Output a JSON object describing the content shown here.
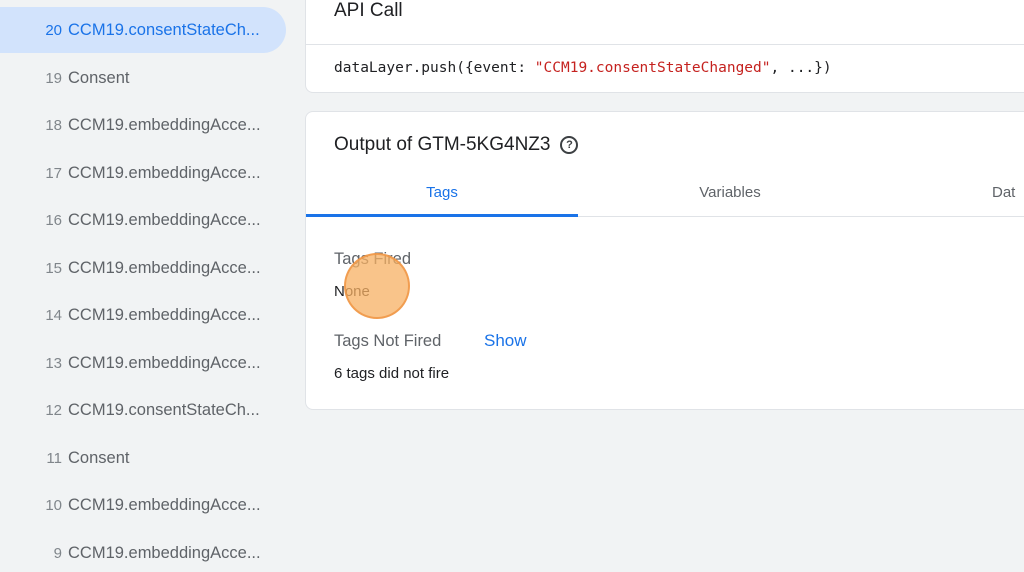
{
  "sidebar": {
    "items": [
      {
        "num": "20",
        "label": "CCM19.consentStateCh...",
        "active": true
      },
      {
        "num": "19",
        "label": "Consent"
      },
      {
        "num": "18",
        "label": "CCM19.embeddingAcce..."
      },
      {
        "num": "17",
        "label": "CCM19.embeddingAcce..."
      },
      {
        "num": "16",
        "label": "CCM19.embeddingAcce..."
      },
      {
        "num": "15",
        "label": "CCM19.embeddingAcce..."
      },
      {
        "num": "14",
        "label": "CCM19.embeddingAcce..."
      },
      {
        "num": "13",
        "label": "CCM19.embeddingAcce..."
      },
      {
        "num": "12",
        "label": "CCM19.consentStateCh..."
      },
      {
        "num": "11",
        "label": "Consent"
      },
      {
        "num": "10",
        "label": "CCM19.embeddingAcce..."
      },
      {
        "num": "9",
        "label": "CCM19.embeddingAcce..."
      }
    ]
  },
  "api_call": {
    "title": "API Call",
    "code_prefix": "dataLayer.push({event: ",
    "code_string": "\"CCM19.consentStateChanged\"",
    "code_suffix": ", ...})"
  },
  "output": {
    "title": "Output of GTM-5KG4NZ3",
    "help_icon": "help-circle-icon",
    "tabs": [
      {
        "label": "Tags",
        "active": true
      },
      {
        "label": "Variables"
      },
      {
        "label": "Dat"
      }
    ],
    "tags_fired": {
      "label": "Tags Fired",
      "value": "None"
    },
    "tags_not_fired": {
      "label": "Tags Not Fired",
      "show_label": "Show",
      "value": "6 tags did not fire"
    }
  },
  "colors": {
    "accent": "#1a73e8",
    "active_bg": "#d2e3fc",
    "code_string": "#c5221f",
    "click_indicator": "#f7b063"
  }
}
